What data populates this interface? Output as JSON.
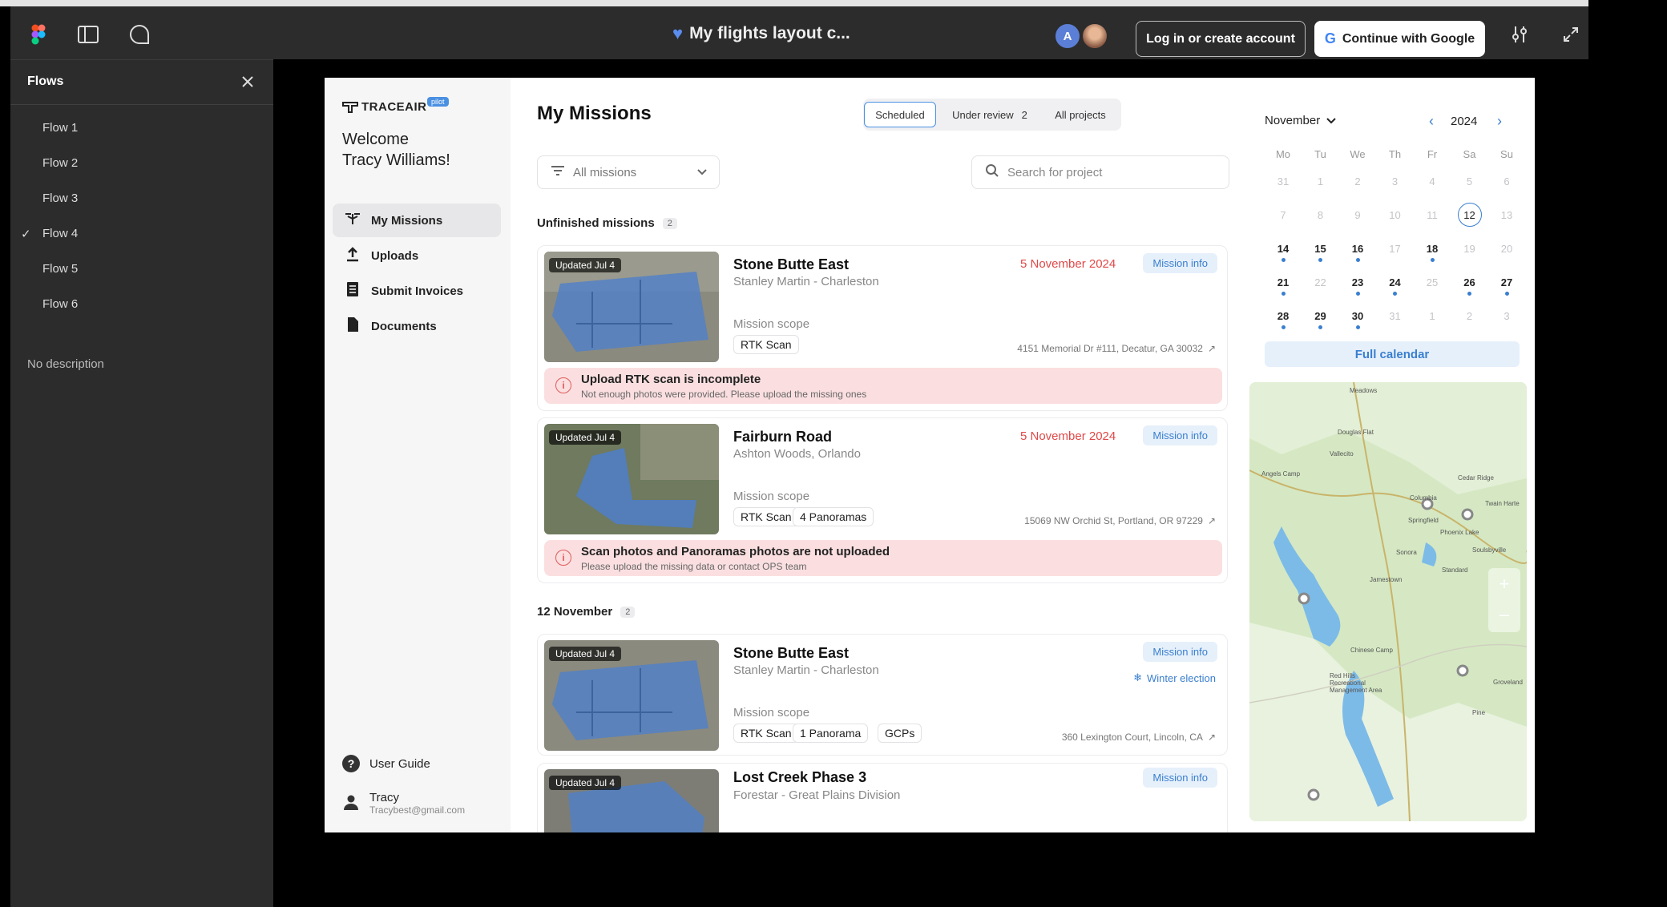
{
  "toolbar": {
    "title": "My flights layout c...",
    "login_label": "Log in or create account",
    "google_label": "Continue with Google",
    "avatar_letter": "A"
  },
  "flows": {
    "title": "Flows",
    "items": [
      "Flow 1",
      "Flow 2",
      "Flow 3",
      "Flow 4",
      "Flow 5",
      "Flow 6"
    ],
    "selected": "Flow 4",
    "description": "No description"
  },
  "app": {
    "logo": "TRACEAIR",
    "logo_badge": "pilot",
    "welcome_line1": "Welcome",
    "welcome_line2": "Tracy Williams!",
    "nav": [
      "My Missions",
      "Uploads",
      "Submit Invoices",
      "Documents"
    ],
    "user_guide": "User Guide",
    "user_name": "Tracy",
    "user_email": "Tracybest@gmail.com",
    "page_title": "My Missions",
    "tabs": [
      {
        "label": "Scheduled",
        "count": ""
      },
      {
        "label": "Under review",
        "count": "2"
      },
      {
        "label": "All projects",
        "count": ""
      }
    ],
    "filter_label": "All missions",
    "search_placeholder": "Search for project",
    "section_unfinished": "Unfinished missions",
    "section_unfinished_count": "2",
    "section_nov": "12 November",
    "section_nov_count": "2",
    "mission_info_label": "Mission info",
    "mission_scope_label": "Mission scope",
    "updated_label": "Updated Jul 4",
    "missions": [
      {
        "title": "Stone Butte East",
        "subtitle": "Stanley Martin - Charleston",
        "date": "5 November 2024",
        "chips": [
          "RTK Scan"
        ],
        "address": "4151 Memorial Dr #111, Decatur, GA 30032",
        "alert_title": "Upload RTK scan is incomplete",
        "alert_text": "Not enough photos were provided. Please upload the missing ones"
      },
      {
        "title": "Fairburn Road",
        "subtitle": "Ashton Woods, Orlando",
        "date": "5 November 2024",
        "chips": [
          "RTK Scan",
          "4 Panoramas"
        ],
        "address": "15069 NW Orchid St, Portland, OR 97229",
        "alert_title": "Scan photos and Panoramas photos are not uploaded",
        "alert_text": "Please upload the missing data or contact OPS team"
      },
      {
        "title": "Stone Butte East",
        "subtitle": "Stanley Martin - Charleston",
        "tag": "Winter election",
        "chips": [
          "RTK Scan",
          "1 Panorama",
          "GCPs"
        ],
        "address": "360 Lexington Court, Lincoln, CA"
      },
      {
        "title": "Lost Creek Phase 3",
        "subtitle": "Forestar - Great Plains Division"
      }
    ]
  },
  "calendar": {
    "month": "November",
    "year": "2024",
    "weekdays": [
      "Mo",
      "Tu",
      "We",
      "Th",
      "Fr",
      "Sa",
      "Su"
    ],
    "weeks": [
      [
        "31",
        "1",
        "2",
        "3",
        "4",
        "5",
        "6"
      ],
      [
        "7",
        "8",
        "9",
        "10",
        "11",
        "12",
        "13"
      ],
      [
        "14",
        "15",
        "16",
        "17",
        "18",
        "19",
        "20"
      ],
      [
        "21",
        "22",
        "23",
        "24",
        "25",
        "26",
        "27"
      ],
      [
        "28",
        "29",
        "30",
        "31",
        "1",
        "2",
        "3"
      ]
    ],
    "today": "12",
    "full_calendar": "Full calendar"
  },
  "map": {
    "labels": [
      "Meadows",
      "Douglas Flat",
      "Vallecito",
      "Angels Camp",
      "Cedar Ridge",
      "Twain Harte",
      "Columbia",
      "Springfield",
      "Phoenix Lake",
      "Sonora",
      "Soulsbyville",
      "Standard",
      "Jamestown",
      "Chinese Camp",
      "Red Hills Recreational Management Area",
      "Groveland",
      "Pine"
    ]
  },
  "colors": {
    "accent": "#4a90e2",
    "alert_bg": "#fbdfe0",
    "date_red": "#e04848",
    "toolbar": "#2c2c2c"
  }
}
